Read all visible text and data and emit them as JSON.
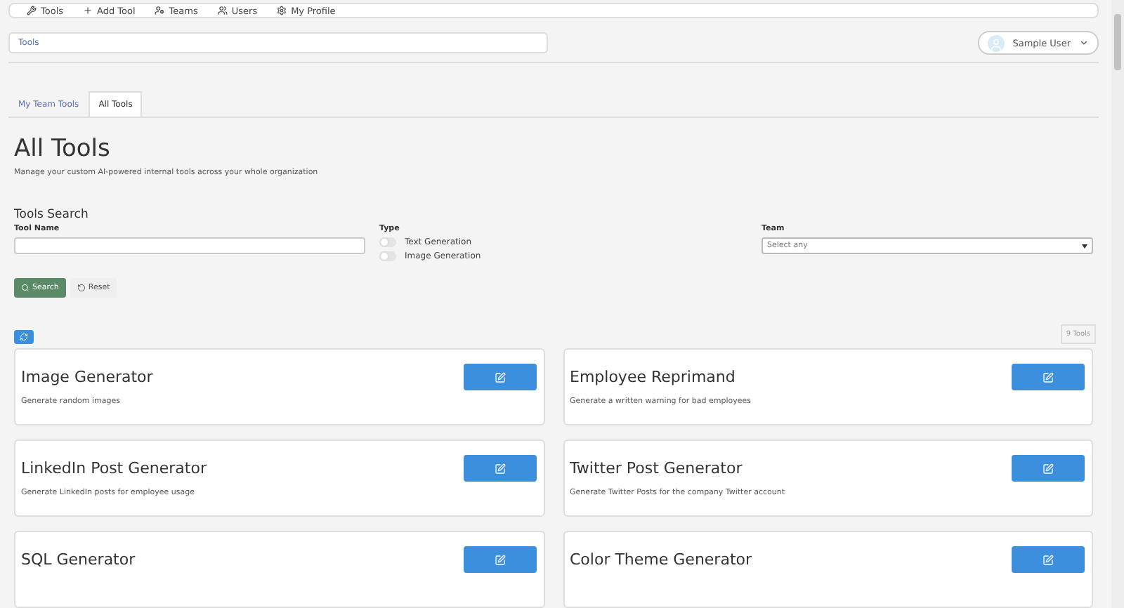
{
  "nav": [
    {
      "label": "Tools"
    },
    {
      "label": "Add Tool"
    },
    {
      "label": "Teams"
    },
    {
      "label": "Users"
    },
    {
      "label": "My Profile"
    }
  ],
  "breadcrumb": "Tools",
  "user": {
    "name": "Sample User"
  },
  "tabs": [
    {
      "label": "My Team Tools",
      "selected": false
    },
    {
      "label": "All Tools",
      "selected": true
    }
  ],
  "title": "All Tools",
  "subtitle": "Manage your custom AI-powered internal tools across your whole organization",
  "search": {
    "title": "Tools Search",
    "tool_name_label": "Tool Name",
    "type_label": "Type",
    "types": [
      {
        "label": "Text Generation",
        "on": false
      },
      {
        "label": "Image Generation",
        "on": false
      }
    ],
    "team_label": "Team",
    "team_placeholder": "Select any",
    "search_button": "Search",
    "reset_button": "Reset"
  },
  "count": "9 Tools",
  "tools": [
    {
      "name": "Image Generator",
      "description": "Generate random images"
    },
    {
      "name": "Employee Reprimand",
      "description": "Generate a written warning for bad employees"
    },
    {
      "name": "LinkedIn Post Generator",
      "description": "Generate LinkedIn posts for employee usage"
    },
    {
      "name": "Twitter Post Generator",
      "description": "Generate Twitter Posts for the company Twitter account"
    },
    {
      "name": "SQL Generator"
    },
    {
      "name": "Color Theme Generator"
    }
  ]
}
